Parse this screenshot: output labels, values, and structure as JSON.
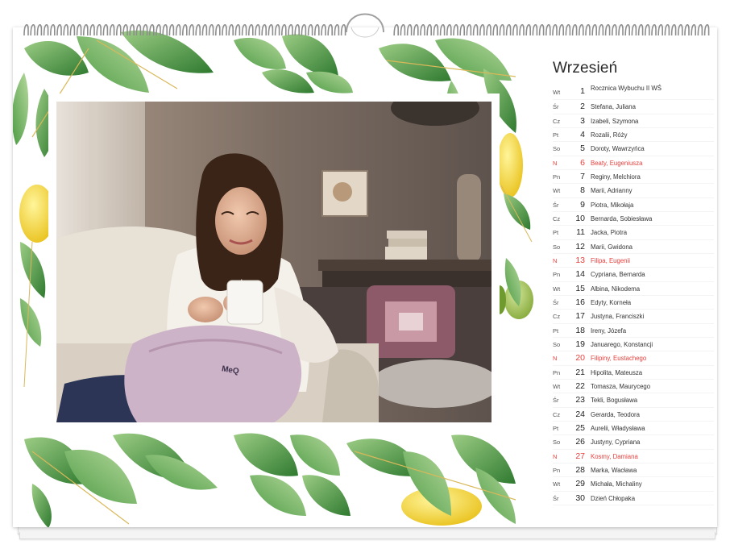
{
  "calendar": {
    "month": "Wrzesień",
    "days": [
      {
        "weekday": "Wt",
        "day": "1",
        "names": "Rocznica Wybuchu II WŚ",
        "holiday": false
      },
      {
        "weekday": "Śr",
        "day": "2",
        "names": "Stefana, Juliana",
        "holiday": false
      },
      {
        "weekday": "Cz",
        "day": "3",
        "names": "Izabeli, Szymona",
        "holiday": false
      },
      {
        "weekday": "Pt",
        "day": "4",
        "names": "Rozalii, Róży",
        "holiday": false
      },
      {
        "weekday": "So",
        "day": "5",
        "names": "Doroty, Wawrzyńca",
        "holiday": false
      },
      {
        "weekday": "N",
        "day": "6",
        "names": "Beaty, Eugeniusza",
        "holiday": true
      },
      {
        "weekday": "Pn",
        "day": "7",
        "names": "Reginy, Melchiora",
        "holiday": false
      },
      {
        "weekday": "Wt",
        "day": "8",
        "names": "Marii, Adrianny",
        "holiday": false
      },
      {
        "weekday": "Śr",
        "day": "9",
        "names": "Piotra, Mikołaja",
        "holiday": false
      },
      {
        "weekday": "Cz",
        "day": "10",
        "names": "Bernarda, Sobiesława",
        "holiday": false
      },
      {
        "weekday": "Pt",
        "day": "11",
        "names": "Jacka, Piotra",
        "holiday": false
      },
      {
        "weekday": "So",
        "day": "12",
        "names": "Marii, Gwidona",
        "holiday": false
      },
      {
        "weekday": "N",
        "day": "13",
        "names": "Filipa, Eugenii",
        "holiday": true
      },
      {
        "weekday": "Pn",
        "day": "14",
        "names": "Cypriana, Bernarda",
        "holiday": false
      },
      {
        "weekday": "Wt",
        "day": "15",
        "names": "Albina, Nikodema",
        "holiday": false
      },
      {
        "weekday": "Śr",
        "day": "16",
        "names": "Edyty, Korneła",
        "holiday": false
      },
      {
        "weekday": "Cz",
        "day": "17",
        "names": "Justyna, Franciszki",
        "holiday": false
      },
      {
        "weekday": "Pt",
        "day": "18",
        "names": "Ireny, Józefa",
        "holiday": false
      },
      {
        "weekday": "So",
        "day": "19",
        "names": "Januarego, Konstancji",
        "holiday": false
      },
      {
        "weekday": "N",
        "day": "20",
        "names": "Filipiny, Eustachego",
        "holiday": true
      },
      {
        "weekday": "Pn",
        "day": "21",
        "names": "Hipolita, Mateusza",
        "holiday": false
      },
      {
        "weekday": "Wt",
        "day": "22",
        "names": "Tomasza, Maurycego",
        "holiday": false
      },
      {
        "weekday": "Śr",
        "day": "23",
        "names": "Tekli, Bogusława",
        "holiday": false
      },
      {
        "weekday": "Cz",
        "day": "24",
        "names": "Gerarda, Teodora",
        "holiday": false
      },
      {
        "weekday": "Pt",
        "day": "25",
        "names": "Aurelii, Władysława",
        "holiday": false
      },
      {
        "weekday": "So",
        "day": "26",
        "names": "Justyny, Cypriana",
        "holiday": false
      },
      {
        "weekday": "N",
        "day": "27",
        "names": "Kosmy, Damiana",
        "holiday": true
      },
      {
        "weekday": "Pn",
        "day": "28",
        "names": "Marka, Wacława",
        "holiday": false
      },
      {
        "weekday": "Wt",
        "day": "29",
        "names": "Michała, Michaliny",
        "holiday": false
      },
      {
        "weekday": "Śr",
        "day": "30",
        "names": "Dzień Chłopaka",
        "holiday": false
      }
    ]
  },
  "photo": {
    "mug_logo_text": "MeQ"
  },
  "colors": {
    "holiday": "#e8403d",
    "leaf_dark": "#3f8a3a",
    "leaf_light": "#8fc47a",
    "lemon": "#f3d640"
  }
}
